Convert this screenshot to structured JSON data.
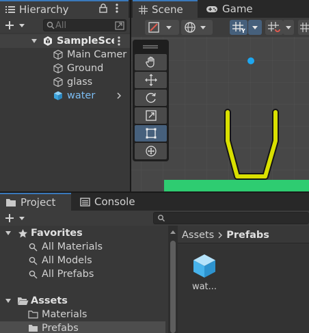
{
  "hierarchy": {
    "tab_label": "Hierarchy",
    "search_placeholder": "All",
    "items": [
      {
        "label": "SampleSce",
        "kind": "scene"
      },
      {
        "label": "Main Camer",
        "kind": "object"
      },
      {
        "label": "Ground",
        "kind": "object"
      },
      {
        "label": "glass",
        "kind": "object"
      },
      {
        "label": "water",
        "kind": "prefab"
      }
    ]
  },
  "scene_view": {
    "tabs": [
      {
        "label": "Scene",
        "active": true
      },
      {
        "label": "Game",
        "active": false
      }
    ],
    "tools": [
      "view-tool",
      "move-tool",
      "rotate-tool",
      "scale-tool",
      "rect-tool",
      "transform-tool"
    ],
    "selected_tool": "rect-tool",
    "colors": {
      "cup_outline": "#d9e000",
      "ground": "#2ecc71",
      "camera_dot": "#1ea7f0",
      "background": "#474747"
    }
  },
  "project": {
    "tabs": [
      {
        "label": "Project",
        "active": true
      },
      {
        "label": "Console",
        "active": false
      }
    ],
    "favorites_label": "Favorites",
    "favorites": [
      "All Materials",
      "All Models",
      "All Prefabs"
    ],
    "assets_label": "Assets",
    "asset_folders": [
      "Materials",
      "Prefabs"
    ],
    "breadcrumb": {
      "root": "Assets",
      "current": "Prefabs"
    },
    "grid_items": [
      {
        "label": "wat...",
        "icon": "prefab-cube-icon"
      }
    ]
  }
}
